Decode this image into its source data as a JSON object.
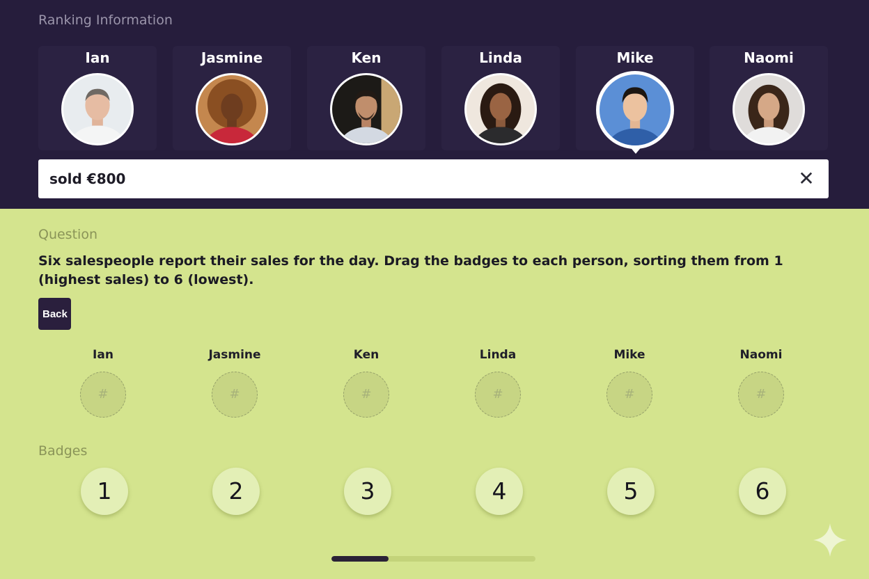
{
  "ranking": {
    "title": "Ranking Information",
    "people": [
      {
        "name": "Ian"
      },
      {
        "name": "Jasmine"
      },
      {
        "name": "Ken"
      },
      {
        "name": "Linda"
      },
      {
        "name": "Mike",
        "selected": true
      },
      {
        "name": "Naomi"
      }
    ],
    "info": "sold €800"
  },
  "question": {
    "label": "Question",
    "text": "Six salespeople report their sales for the day. Drag the badges to each person, sorting them from 1 (highest sales) to 6 (lowest).",
    "back_label": "Back"
  },
  "slots": {
    "names": [
      "Ian",
      "Jasmine",
      "Ken",
      "Linda",
      "Mike",
      "Naomi"
    ],
    "placeholder": "#"
  },
  "badges": {
    "label": "Badges",
    "values": [
      "1",
      "2",
      "3",
      "4",
      "5",
      "6"
    ]
  },
  "progress": {
    "fraction": 0.28
  },
  "colors": {
    "header_bg": "#261d3c",
    "body_bg": "#d4e48e",
    "badge_bg": "#e3efb6"
  }
}
